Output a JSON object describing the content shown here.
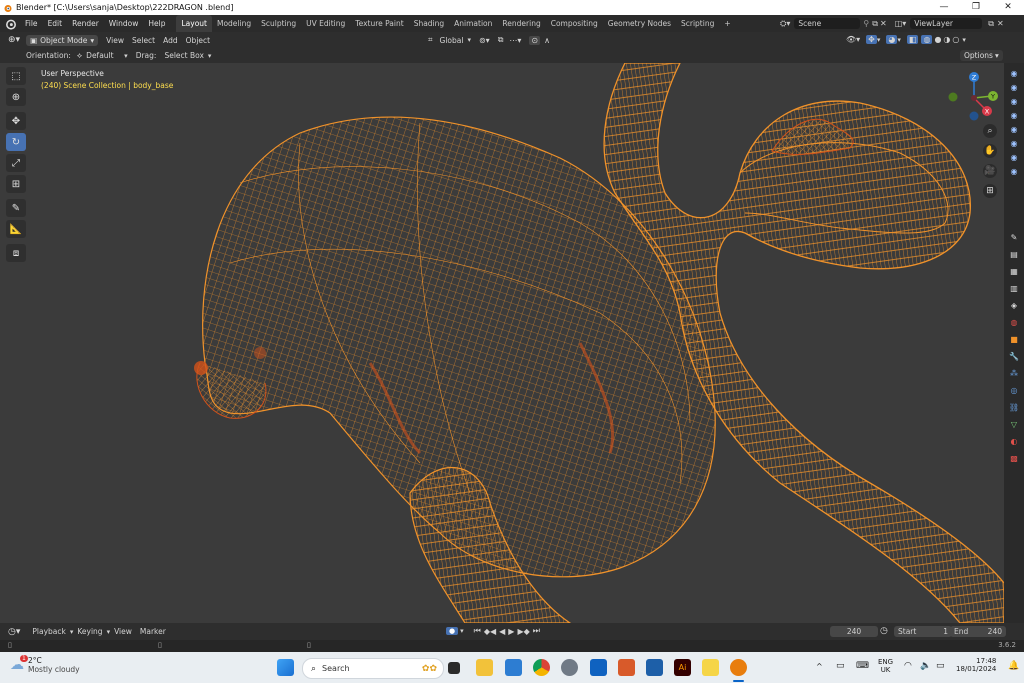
{
  "window": {
    "title": "Blender* [C:\\Users\\sanja\\Desktop\\222DRAGON .blend]",
    "minimize": "—",
    "maximize": "❐",
    "close": "✕"
  },
  "menu": [
    "File",
    "Edit",
    "Render",
    "Window",
    "Help"
  ],
  "workspaces": [
    "Layout",
    "Modeling",
    "Sculpting",
    "UV Editing",
    "Texture Paint",
    "Shading",
    "Animation",
    "Rendering",
    "Compositing",
    "Geometry Nodes",
    "Scripting",
    "+"
  ],
  "active_workspace": "Layout",
  "scene": {
    "name": "Scene",
    "view_layer": "ViewLayer"
  },
  "view_header": {
    "mode": "Object Mode",
    "items": [
      "View",
      "Select",
      "Add",
      "Object"
    ],
    "transform": "Global"
  },
  "tool_header": {
    "orientation_label": "Orientation:",
    "orientation_value": "Default",
    "drag_label": "Drag:",
    "drag_value": "Select Box",
    "options": "Options"
  },
  "viewport": {
    "perspective": "User Perspective",
    "collection": "(240) Scene Collection | body_base"
  },
  "gizmo": {
    "z": "Z",
    "y": "Y",
    "x": "X"
  },
  "timeline": {
    "items": [
      "Playback",
      "Keying",
      "View",
      "Marker"
    ],
    "current_frame": "240",
    "start_label": "Start",
    "start": "1",
    "end_label": "End",
    "end": "240"
  },
  "statusbar": {
    "version": "3.6.2"
  },
  "taskbar": {
    "weather_temp": "2°C",
    "weather_desc": "Mostly cloudy",
    "search_placeholder": "Search",
    "lang": "ENG",
    "region": "UK",
    "time": "17:48",
    "date": "18/01/2024",
    "notification_count": "1"
  },
  "colors": {
    "wire": "#f0922a",
    "wire_dark": "#d2521a",
    "active_blue": "#4772b3",
    "bg_viewport": "#3b3b3b"
  }
}
